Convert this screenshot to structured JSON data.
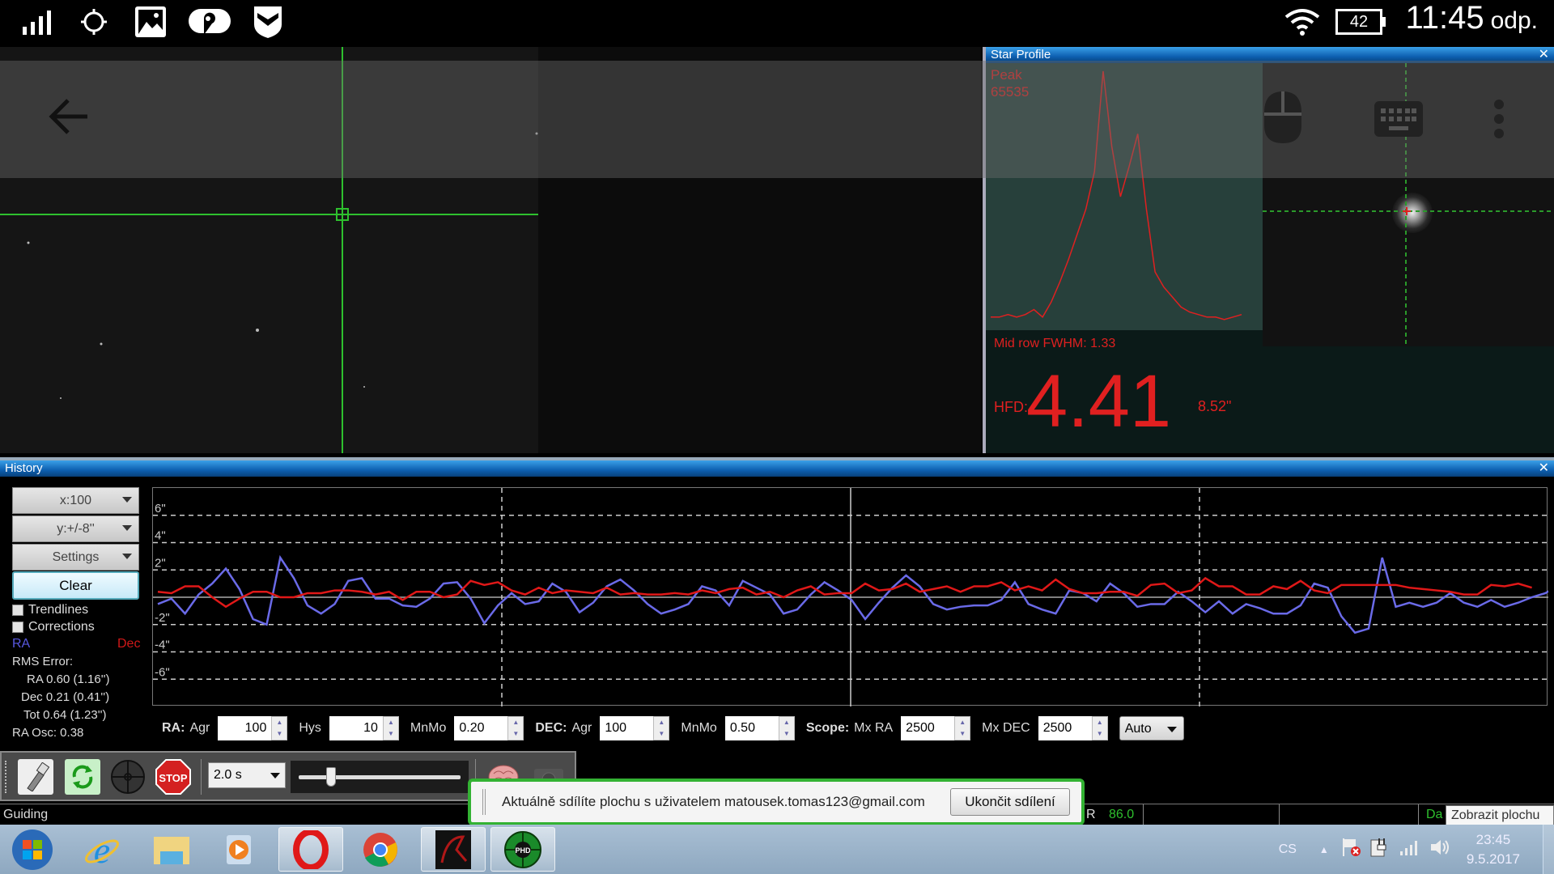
{
  "android_status": {
    "left_icons": [
      "signal-icon",
      "gps-icon",
      "gallery-icon",
      "maps-icon",
      "shield-icon"
    ],
    "battery": "42",
    "time": "11:45",
    "ampm": "odp."
  },
  "remote_overlay": {
    "back_icon": "back-arrow-icon",
    "icons": [
      "mouse-icon",
      "keyboard-icon",
      "more-vert-icon"
    ]
  },
  "star_profile": {
    "title": "Star Profile",
    "close": "✕",
    "peak_label": "Peak",
    "peak_value": "65535",
    "fwhm_label": "Mid row FWHM: 1.33",
    "hfd_label": "HFD:",
    "hfd_value": "4.41",
    "hfd_arcsec": "8.52\"",
    "profile_points": [
      0.02,
      0.02,
      0.03,
      0.02,
      0.03,
      0.05,
      0.02,
      0.08,
      0.16,
      0.25,
      0.35,
      0.45,
      0.6,
      1.0,
      0.7,
      0.5,
      0.62,
      0.75,
      0.45,
      0.2,
      0.14,
      0.1,
      0.06,
      0.04,
      0.03,
      0.02,
      0.02,
      0.01,
      0.02,
      0.03
    ]
  },
  "history": {
    "title": "History",
    "close": "✕",
    "x_scale": "x:100",
    "y_scale": "y:+/-8''",
    "settings": "Settings",
    "clear": "Clear",
    "trendlines": "Trendlines",
    "corrections": "Corrections",
    "ra_legend": "RA",
    "dec_legend": "Dec",
    "rms_title": "RMS Error:",
    "rms_ra": "RA  0.60 (1.16'')",
    "rms_dec": "Dec  0.21 (0.41'')",
    "rms_tot": "Tot  0.64 (1.23'')",
    "ra_osc": "RA Osc: 0.38",
    "colors": {
      "ra": "#6a6ae8",
      "dec": "#e01818"
    }
  },
  "chart_data": {
    "type": "line",
    "title": "",
    "xlabel": "",
    "ylabel": "",
    "ylim": [
      -8,
      8
    ],
    "y_ticks": [
      "6\"",
      "4\"",
      "2\"",
      "-2\"",
      "-4\"",
      "-6\""
    ],
    "y_tick_values": [
      6,
      4,
      2,
      -2,
      -4,
      -6
    ],
    "x_count": 100,
    "grid": true,
    "series": [
      {
        "name": "RA",
        "color": "#6a6ae8",
        "values": [
          -0.5,
          -0.1,
          -1.2,
          0.2,
          1.0,
          2.1,
          0.6,
          -1.6,
          -2.0,
          2.9,
          1.4,
          -0.6,
          -1.2,
          -0.5,
          1.2,
          1.4,
          -0.1,
          -0.1,
          -0.6,
          -0.7,
          -0.1,
          1.0,
          1.1,
          -0.1,
          -1.9,
          -0.6,
          0.3,
          -0.5,
          -0.3,
          1.0,
          0.4,
          -1.1,
          -0.4,
          0.8,
          1.3,
          0.5,
          -0.5,
          -1.2,
          -0.9,
          -0.5,
          0.8,
          0.5,
          -0.6,
          1.2,
          0.7,
          0.2,
          -1.2,
          -0.9,
          0.2,
          1.1,
          0.5,
          -0.2,
          -1.6,
          -0.4,
          0.7,
          1.6,
          0.8,
          -0.5,
          -0.9,
          -0.7,
          -0.6,
          -0.6,
          -0.2,
          1.1,
          -0.5,
          -0.9,
          -1.2,
          0.5,
          0.3,
          -0.3,
          1.0,
          0.3,
          -0.7,
          -0.5,
          -0.5,
          0.4,
          -0.3,
          -1.1,
          -0.3,
          -1.2,
          -0.5,
          -0.8,
          -1.2,
          -1.2,
          -0.6,
          1.0,
          0.7,
          -1.4,
          -2.6,
          -2.3,
          2.9,
          -0.7,
          -0.4,
          -0.7,
          -0.4,
          0.3,
          -0.4,
          -0.7,
          -0.2,
          -0.7,
          -0.4,
          0.0,
          0.3,
          0.9,
          0.9,
          0.2,
          -0.4,
          -0.1,
          -0.4,
          0.0
        ]
      },
      {
        "name": "Dec",
        "color": "#e01818",
        "values": [
          0.4,
          0.3,
          0.8,
          0.8,
          0.0,
          -0.7,
          -0.1,
          0.4,
          0.4,
          0.0,
          0.0,
          0.3,
          0.3,
          0.5,
          0.5,
          0.4,
          0.2,
          0.4,
          -0.2,
          0.4,
          0.4,
          0.0,
          0.2,
          1.2,
          0.9,
          1.1,
          0.5,
          0.2,
          0.7,
          0.3,
          0.5,
          0.4,
          0.3,
          0.7,
          0.2,
          0.3,
          0.2,
          0.2,
          0.3,
          0.2,
          0.5,
          0.3,
          0.6,
          0.7,
          0.2,
          0.4,
          0.0,
          0.5,
          0.8,
          0.2,
          0.3,
          0.3,
          1.0,
          0.5,
          0.6,
          1.0,
          0.4,
          0.6,
          0.8,
          0.4,
          0.8,
          0.8,
          1.1,
          0.5,
          0.8,
          0.5,
          1.3,
          0.6,
          0.3,
          0.3,
          0.4,
          0.4,
          0.1,
          0.9,
          1.0,
          0.3,
          0.5,
          1.4,
          0.8,
          0.8,
          0.2,
          0.2,
          0.8,
          0.6,
          1.2,
          0.5,
          0.3,
          0.9,
          0.9,
          0.9,
          0.9,
          0.9,
          0.7,
          0.6,
          0.5,
          0.4,
          0.2,
          0.2,
          0.9,
          0.8,
          1.0,
          0.7
        ]
      }
    ]
  },
  "guide_params": {
    "ra_label": "RA:",
    "ra_agr_label": "Agr",
    "ra_agr": "100",
    "hys_label": "Hys",
    "hys": "10",
    "ra_mnmo_label": "MnMo",
    "ra_mnmo": "0.20",
    "dec_label": "DEC:",
    "dec_agr_label": "Agr",
    "dec_agr": "100",
    "dec_mnmo_label": "MnMo",
    "dec_mnmo": "0.50",
    "scope_label": "Scope:",
    "mxra_label": "Mx RA",
    "mxra": "2500",
    "mxdec_label": "Mx DEC",
    "mxdec": "2500",
    "mode": "Auto"
  },
  "toolbar": {
    "exposure": "2.0 s",
    "stop_label": "STOP",
    "gamma_level": 0.2
  },
  "statusline": {
    "state": "Guiding",
    "snr_label": "R",
    "snr_value": "86.0",
    "dark": "Da"
  },
  "share": {
    "message": "Aktuálně sdílíte plochu s uživatelem matousek.tomas123@gmail.com",
    "stop_button": "Ukončit sdílení"
  },
  "tooltip": "Zobrazit plochu",
  "taskbar": {
    "apps": [
      "start-orb",
      "internet-explorer",
      "file-explorer",
      "media-player",
      "opera",
      "chrome",
      "app-red",
      "phd2"
    ],
    "lang": "CS",
    "time": "23:45",
    "date": "9.5.2017"
  }
}
